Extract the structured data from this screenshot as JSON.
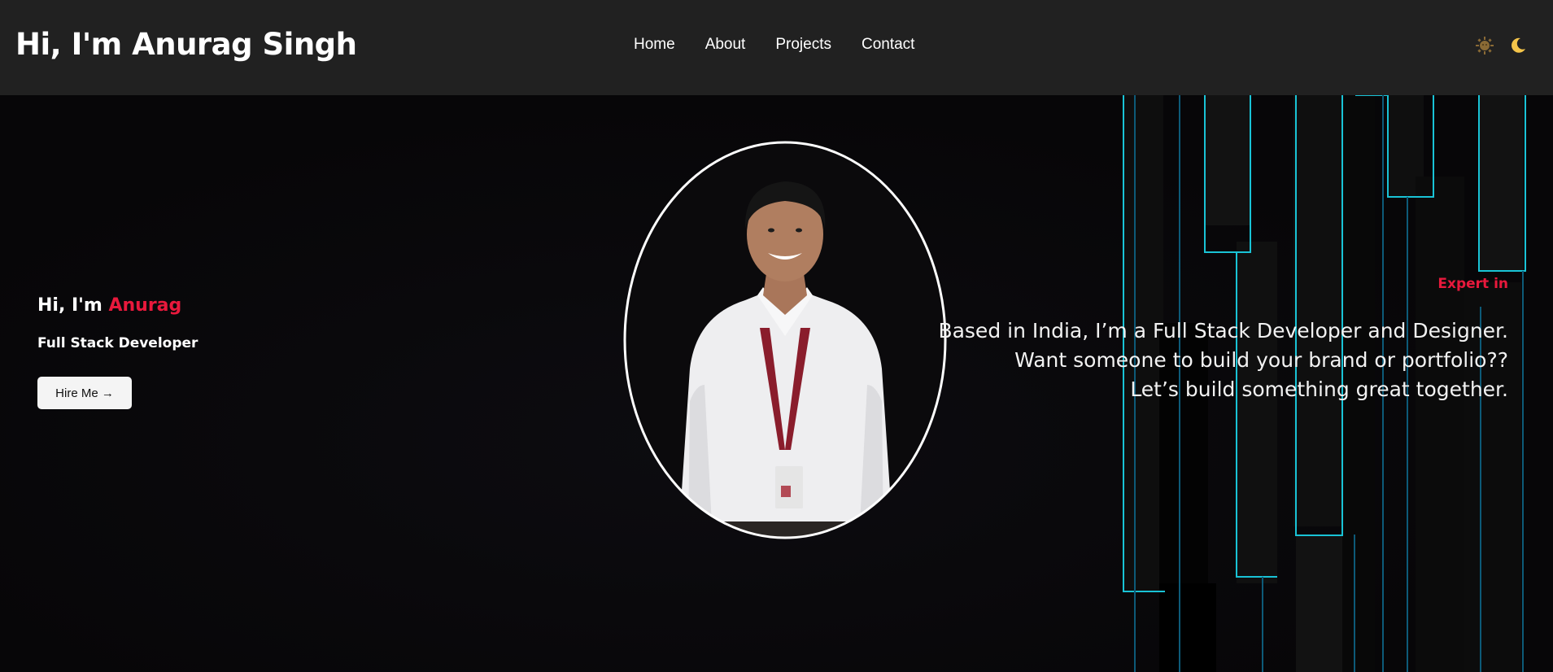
{
  "header": {
    "brand": "Hi, I'm Anurag Singh",
    "nav": [
      "Home",
      "About",
      "Projects",
      "Contact"
    ],
    "icons": [
      "sun-icon",
      "moon-icon"
    ]
  },
  "hero": {
    "greeting_prefix": "Hi, I'm ",
    "greeting_name": "Anurag",
    "role": "Full Stack Developer",
    "cta": "Hire Me →",
    "expert_label": "Expert in",
    "tagline": [
      "Based in India, I’m a Full Stack Developer and Designer.",
      "Want someone to build your brand or portfolio??",
      "Let’s build something great together."
    ]
  },
  "colors": {
    "accent": "#e8193c",
    "header_bg": "#212121",
    "page_bg": "#0a090b",
    "deco_line": "#19c3d6"
  }
}
